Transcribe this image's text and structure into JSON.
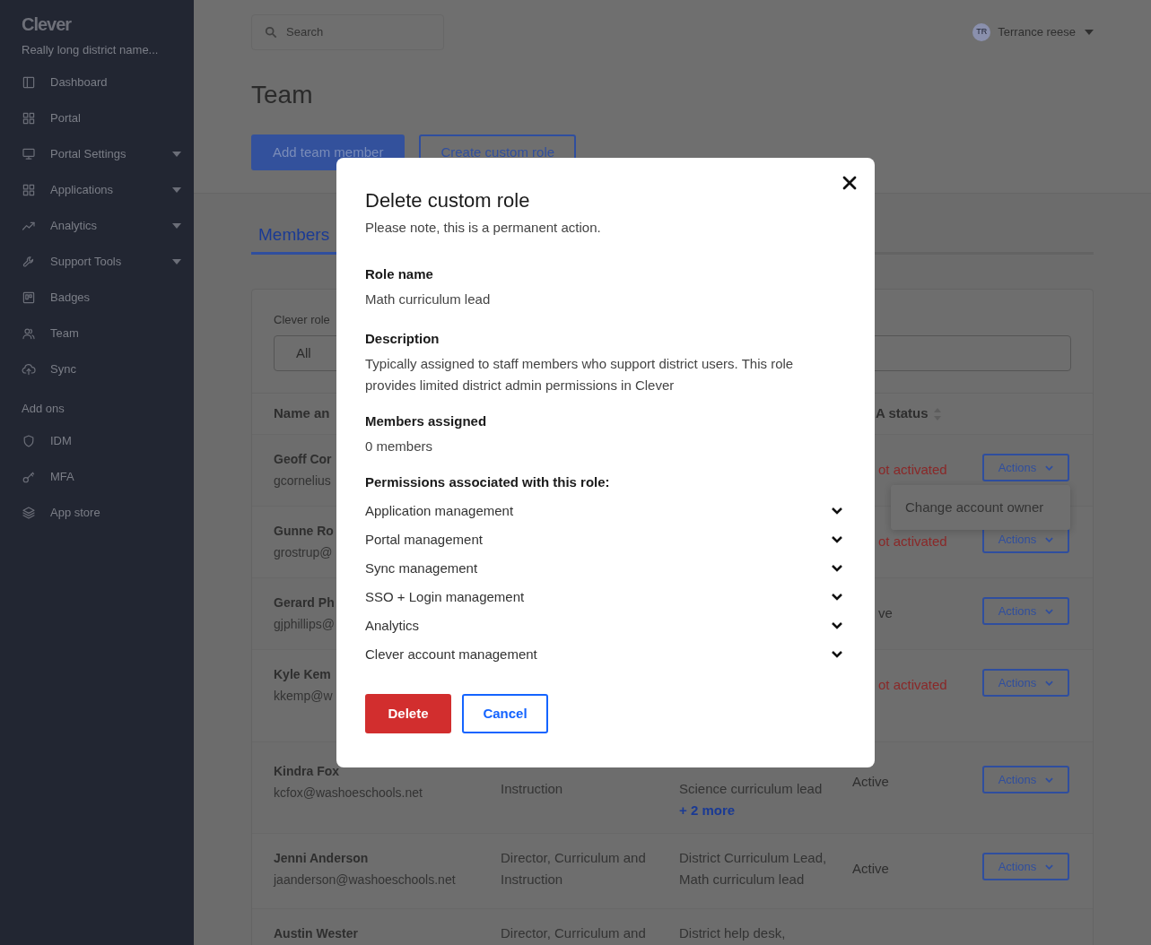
{
  "sidebar": {
    "logo": "Clever",
    "district": "Really long district name...",
    "items": [
      {
        "label": "Dashboard",
        "has_menu": false
      },
      {
        "label": "Portal",
        "has_menu": false
      },
      {
        "label": "Portal Settings",
        "has_menu": true
      },
      {
        "label": "Applications",
        "has_menu": true
      },
      {
        "label": "Analytics",
        "has_menu": true
      },
      {
        "label": "Support Tools",
        "has_menu": true
      },
      {
        "label": "Badges",
        "has_menu": false
      },
      {
        "label": "Team",
        "has_menu": false
      },
      {
        "label": "Sync",
        "has_menu": false
      }
    ],
    "section": "Add ons",
    "addons": [
      {
        "label": "IDM",
        "has_menu": false
      },
      {
        "label": "MFA",
        "has_menu": false
      },
      {
        "label": "App store",
        "has_menu": false
      }
    ]
  },
  "header": {
    "search_placeholder": "Search",
    "user_initials": "TR",
    "user_name": "Terrance reese"
  },
  "page_title": "Team",
  "buttons": [
    {
      "label": "Add team member",
      "kind": "primary"
    },
    {
      "label": "Create custom role",
      "kind": "outline"
    }
  ],
  "tabs": [
    {
      "label": "Members",
      "selected": true
    }
  ],
  "filter": {
    "label": "Clever role",
    "value": "All"
  },
  "table": {
    "columns": [
      "Name an",
      "A status"
    ],
    "rows": [
      {
        "name": "Geoff Cor",
        "email": "gcornelius",
        "status": "ot activated",
        "activated": false,
        "action": "Actions"
      },
      {
        "name": "Gunne Ro",
        "email": "grostrup@",
        "status": "ot activated",
        "activated": false,
        "action": "Actions"
      },
      {
        "name": "Gerard Ph",
        "email": "gjphillips@",
        "status": "ve",
        "activated": true,
        "action": "Actions"
      },
      {
        "name": "Kyle Kem",
        "email": "kkemp@w",
        "status": "ot activated",
        "activated": false,
        "action": "Actions"
      },
      {
        "name": "Kindra Fox",
        "email": "kcfox@washoeschools.net",
        "role": [
          "Instruction"
        ],
        "custom_roles": [
          "Science curriculum lead"
        ],
        "more": "+ 2 more",
        "status": "Active",
        "activated": true,
        "action": "Actions"
      },
      {
        "name": "Jenni Anderson",
        "email": "jaanderson@washoeschools.net",
        "role": [
          "Director, Curriculum and",
          "Instruction"
        ],
        "custom_roles": [
          "District Curriculum Lead,",
          "Math curriculum lead"
        ],
        "status": "Active",
        "activated": true,
        "action": "Actions"
      },
      {
        "name": "Austin Wester",
        "role": [
          "Director, Curriculum and"
        ],
        "custom_roles": [
          "District help desk,"
        ]
      }
    ]
  },
  "dropdown_menu": [
    "Change account owner"
  ],
  "modal": {
    "title": "Delete custom role",
    "subtitle": "Please note, this is a permanent action.",
    "fields": [
      {
        "label": "Role name",
        "value": "Math curriculum lead"
      },
      {
        "label": "Description",
        "value": "Typically assigned to staff members who support district users. This role provides limited district admin permissions in Clever"
      },
      {
        "label": "Members assigned",
        "value": "0 members"
      }
    ],
    "permissions_heading": "Permissions associated with this role:",
    "permissions": [
      {
        "label": "Application management",
        "expanded": false
      },
      {
        "label": "Portal management",
        "expanded": false
      },
      {
        "label": "Sync management",
        "expanded": false
      },
      {
        "label": "SSO + Login management",
        "expanded": false
      },
      {
        "label": "Analytics",
        "expanded": false
      },
      {
        "label": "Clever account management",
        "expanded": false
      }
    ],
    "buttons": [
      {
        "label": "Delete",
        "kind": "danger"
      },
      {
        "label": "Cancel",
        "kind": "outline"
      }
    ]
  }
}
